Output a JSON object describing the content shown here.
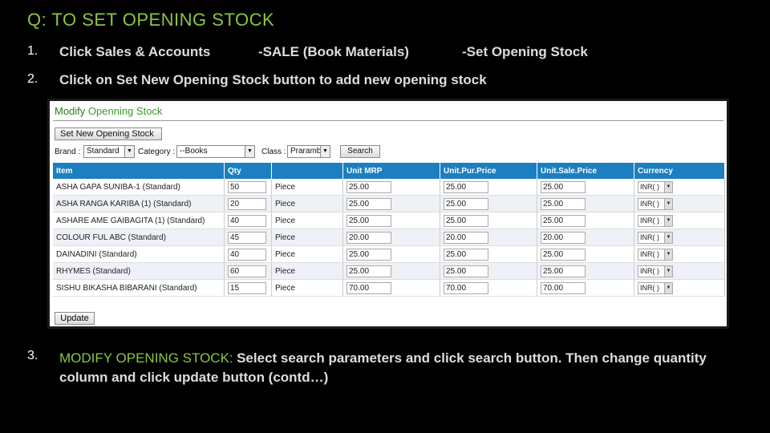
{
  "title": "Q: TO SET OPENING STOCK",
  "steps": {
    "s1_num": "1.",
    "s1_a": "Click Sales & Accounts",
    "s1_b": "-SALE (Book Materials)",
    "s1_c": "-Set Opening Stock",
    "s2_num": "2.",
    "s2_text": "Click on Set New Opening Stock button to add new opening stock",
    "s3_num": "3.",
    "s3_lead": "MODIFY OPENING STOCK:",
    "s3_body": "Select search parameters and click search button. Then change quantity column and click update button (contd…)"
  },
  "panel": {
    "title_a": "Modify",
    "title_b": "Openning Stock",
    "new_button": "Set New Opening Stock",
    "brand_label": "Brand :",
    "brand_value": "Standard",
    "category_label": "Category :",
    "category_value": "--Books",
    "class_label": "Class :",
    "class_value": "Prarambh",
    "search_button": "Search",
    "update_button": "Update"
  },
  "table": {
    "headers": [
      "Item",
      "Qty",
      "",
      "Unit MRP",
      "Unit.Pur.Price",
      "Unit.Sale.Price",
      "Currency"
    ],
    "rows": [
      {
        "item": "ASHA GAPA SUNIBA-1 (Standard)",
        "qty": "50",
        "unit": "Piece",
        "mrp": "25.00",
        "pur": "25.00",
        "sale": "25.00",
        "cur": "INR( )"
      },
      {
        "item": "ASHA RANGA KARIBA (1) (Standard)",
        "qty": "20",
        "unit": "Piece",
        "mrp": "25.00",
        "pur": "25.00",
        "sale": "25.00",
        "cur": "INR( )"
      },
      {
        "item": "ASHARE AME GAIBAGITA (1) (Standard)",
        "qty": "40",
        "unit": "Piece",
        "mrp": "25.00",
        "pur": "25.00",
        "sale": "25.00",
        "cur": "INR( )"
      },
      {
        "item": "COLOUR FUL ABC (Standard)",
        "qty": "45",
        "unit": "Piece",
        "mrp": "20.00",
        "pur": "20.00",
        "sale": "20.00",
        "cur": "INR( )"
      },
      {
        "item": "DAINADINI (Standard)",
        "qty": "40",
        "unit": "Piece",
        "mrp": "25.00",
        "pur": "25.00",
        "sale": "25.00",
        "cur": "INR( )"
      },
      {
        "item": "RHYMES (Standard)",
        "qty": "60",
        "unit": "Piece",
        "mrp": "25.00",
        "pur": "25.00",
        "sale": "25.00",
        "cur": "INR( )"
      },
      {
        "item": "SISHU BIKASHA BIBARANI (Standard)",
        "qty": "15",
        "unit": "Piece",
        "mrp": "70.00",
        "pur": "70.00",
        "sale": "70.00",
        "cur": "INR( )"
      }
    ]
  }
}
